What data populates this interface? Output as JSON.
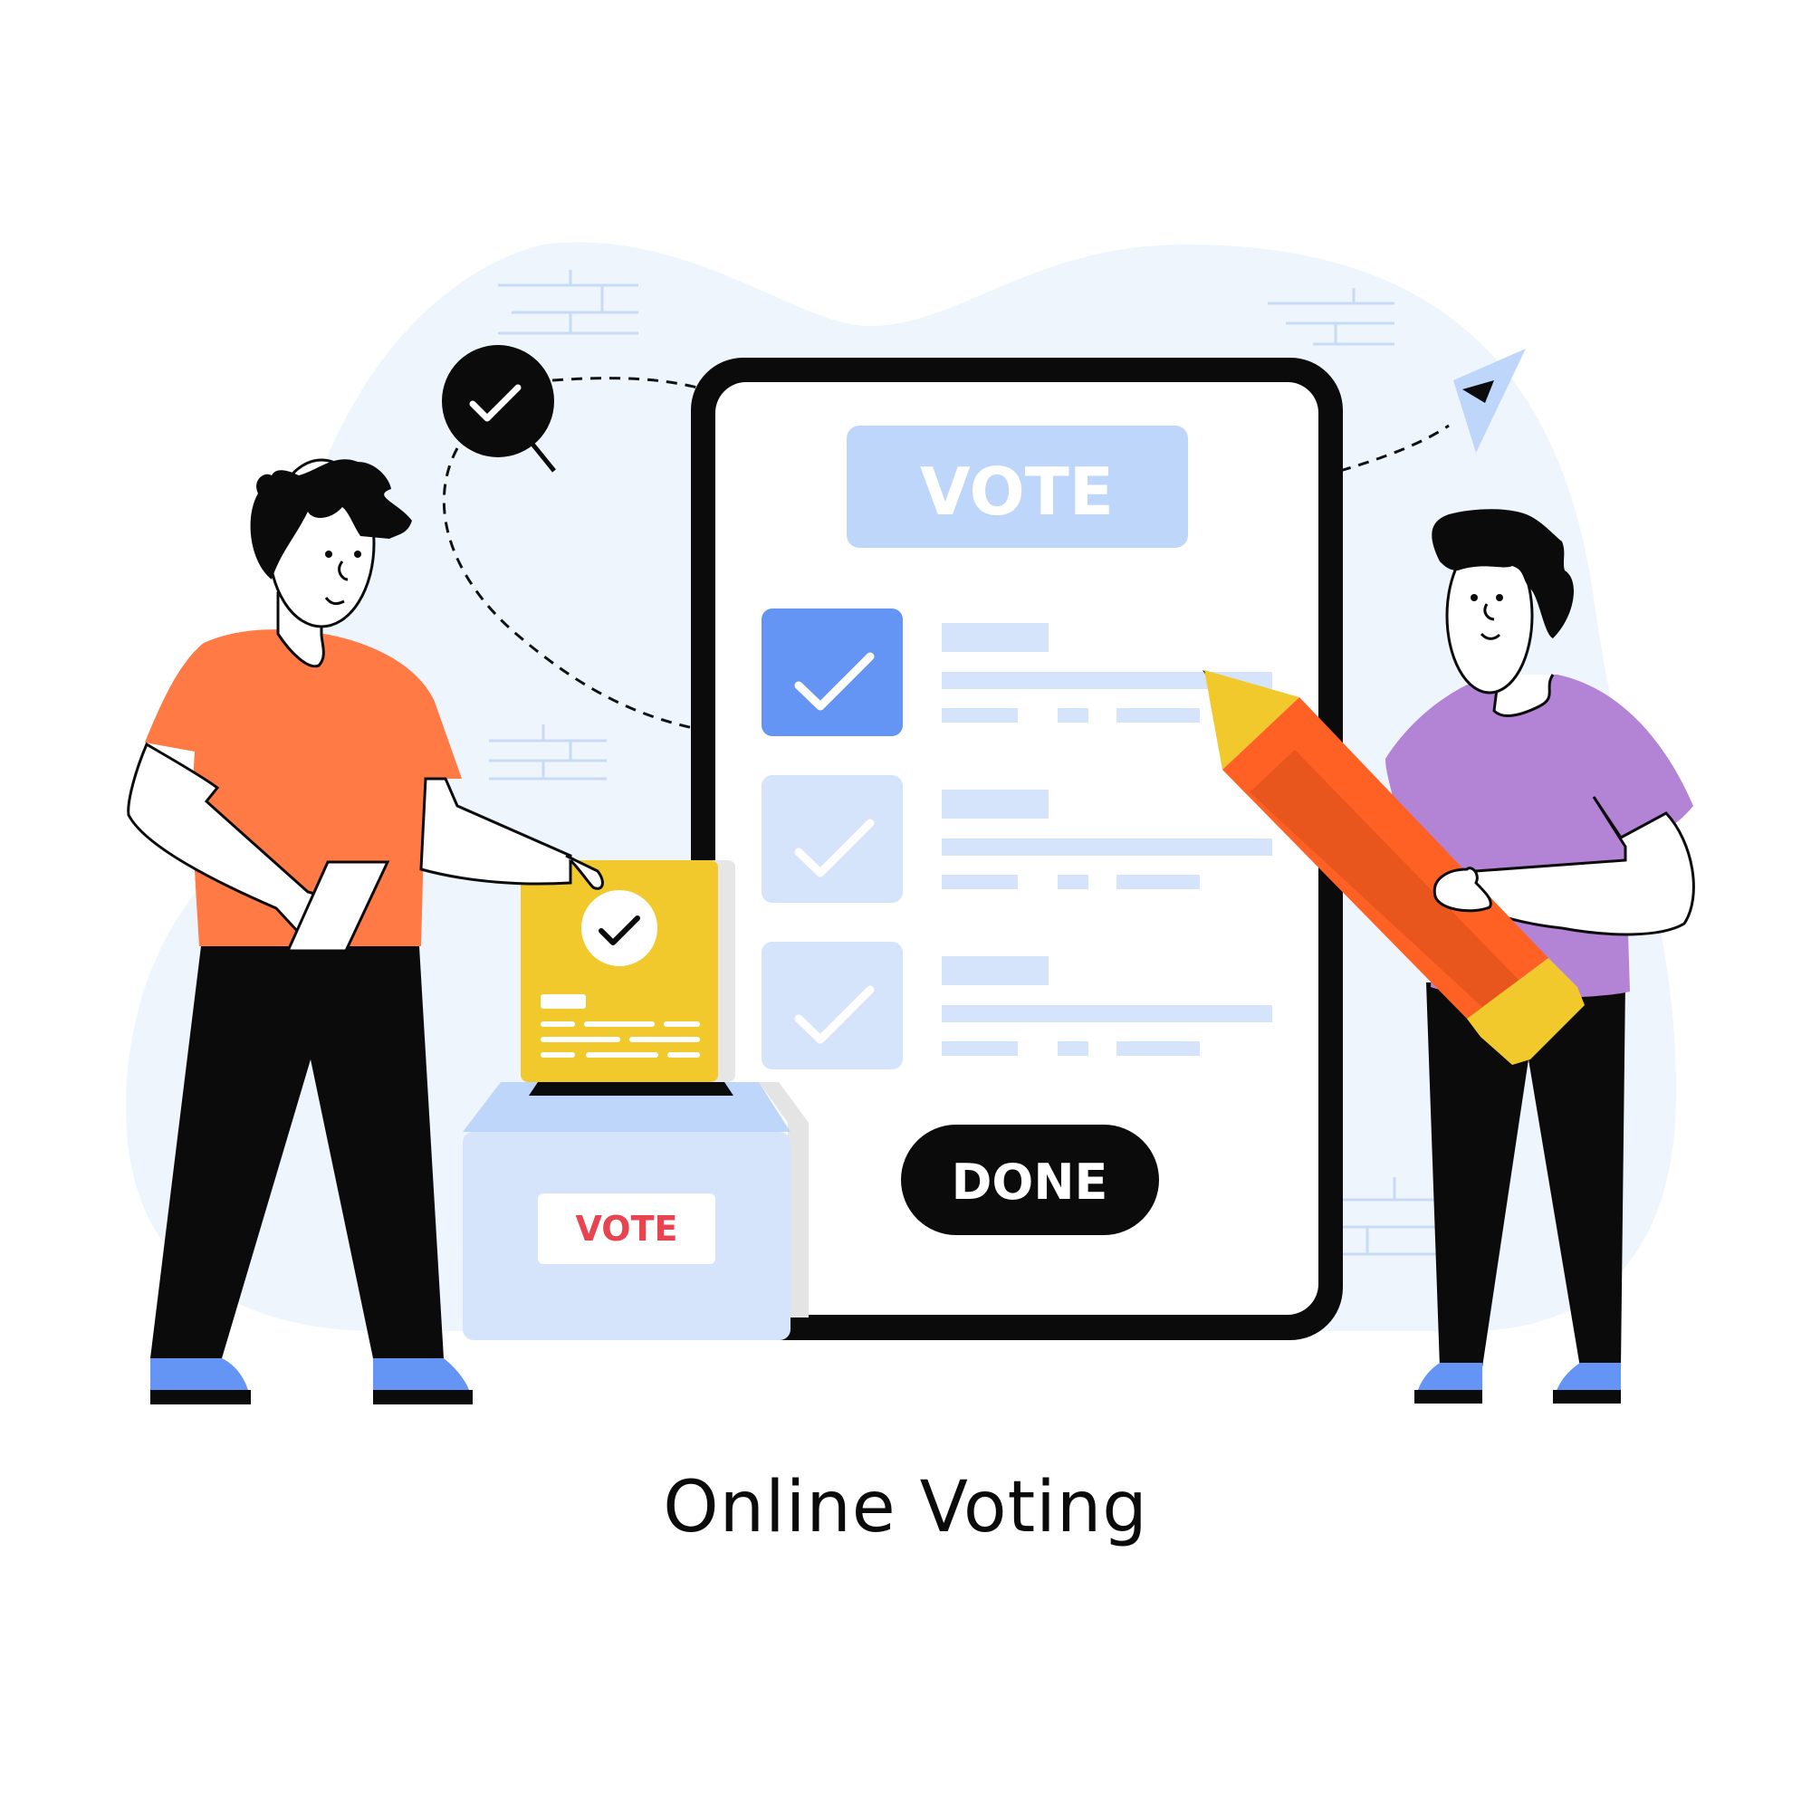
{
  "device": {
    "header_label": "VOTE",
    "done_label": "DONE",
    "options": [
      {
        "checked": true
      },
      {
        "checked": false
      },
      {
        "checked": false
      }
    ]
  },
  "ballot_box": {
    "label": "VOTE"
  },
  "caption": "Online Voting",
  "colors": {
    "background_blob": "#eef5fd",
    "accent_blue": "#6495f5",
    "light_blue": "#bfd6fb",
    "pale_blue": "#d5e4fb",
    "orange_shirt": "#ff7a45",
    "purple_shirt": "#b383d6",
    "yellow": "#f1c92c",
    "pencil_orange": "#ff6124",
    "ink": "#0b0b0b",
    "vote_red": "#e8434f"
  }
}
